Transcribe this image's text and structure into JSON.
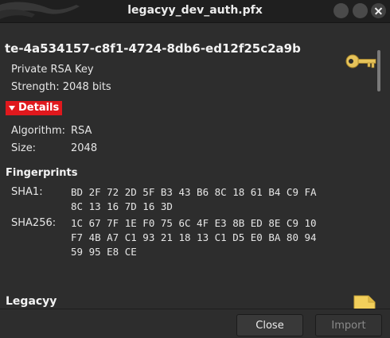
{
  "window": {
    "title": "legacyy_dev_auth.pfx"
  },
  "key": {
    "id": "te-4a534157-c8f1-4724-8db6-ed12f25c2a9b",
    "type": "Private RSA Key",
    "strength": "Strength: 2048 bits",
    "icon": "key-icon"
  },
  "details": {
    "toggle_label": "Details",
    "algorithm_label": "Algorithm:",
    "algorithm_value": "RSA",
    "size_label": "Size:",
    "size_value": "2048"
  },
  "fingerprints": {
    "title": "Fingerprints",
    "sha1_label": "SHA1:",
    "sha1_line1": "BD 2F 72 2D 5F B3 43 B6 8C 18 61 B4 C9 FA",
    "sha1_line2": "8C 13 16 7D 16 3D",
    "sha256_label": "SHA256:",
    "sha256_line1": "1C 67 7F 1E F0 75 6C 4F E3 8B ED 8E C9 10",
    "sha256_line2": "F7 4B A7 C1 93 21 18 13 C1 D5 E0 BA 80 94",
    "sha256_line3": "59 95 E8 CE"
  },
  "next_item": {
    "title": "Legacyy",
    "icon": "certificate-document-icon"
  },
  "footer": {
    "close_label": "Close",
    "import_label": "Import"
  },
  "colors": {
    "details_accent": "#e0181d",
    "key_icon": "#e6c35a",
    "doc_icon": "#f2cf5b"
  }
}
